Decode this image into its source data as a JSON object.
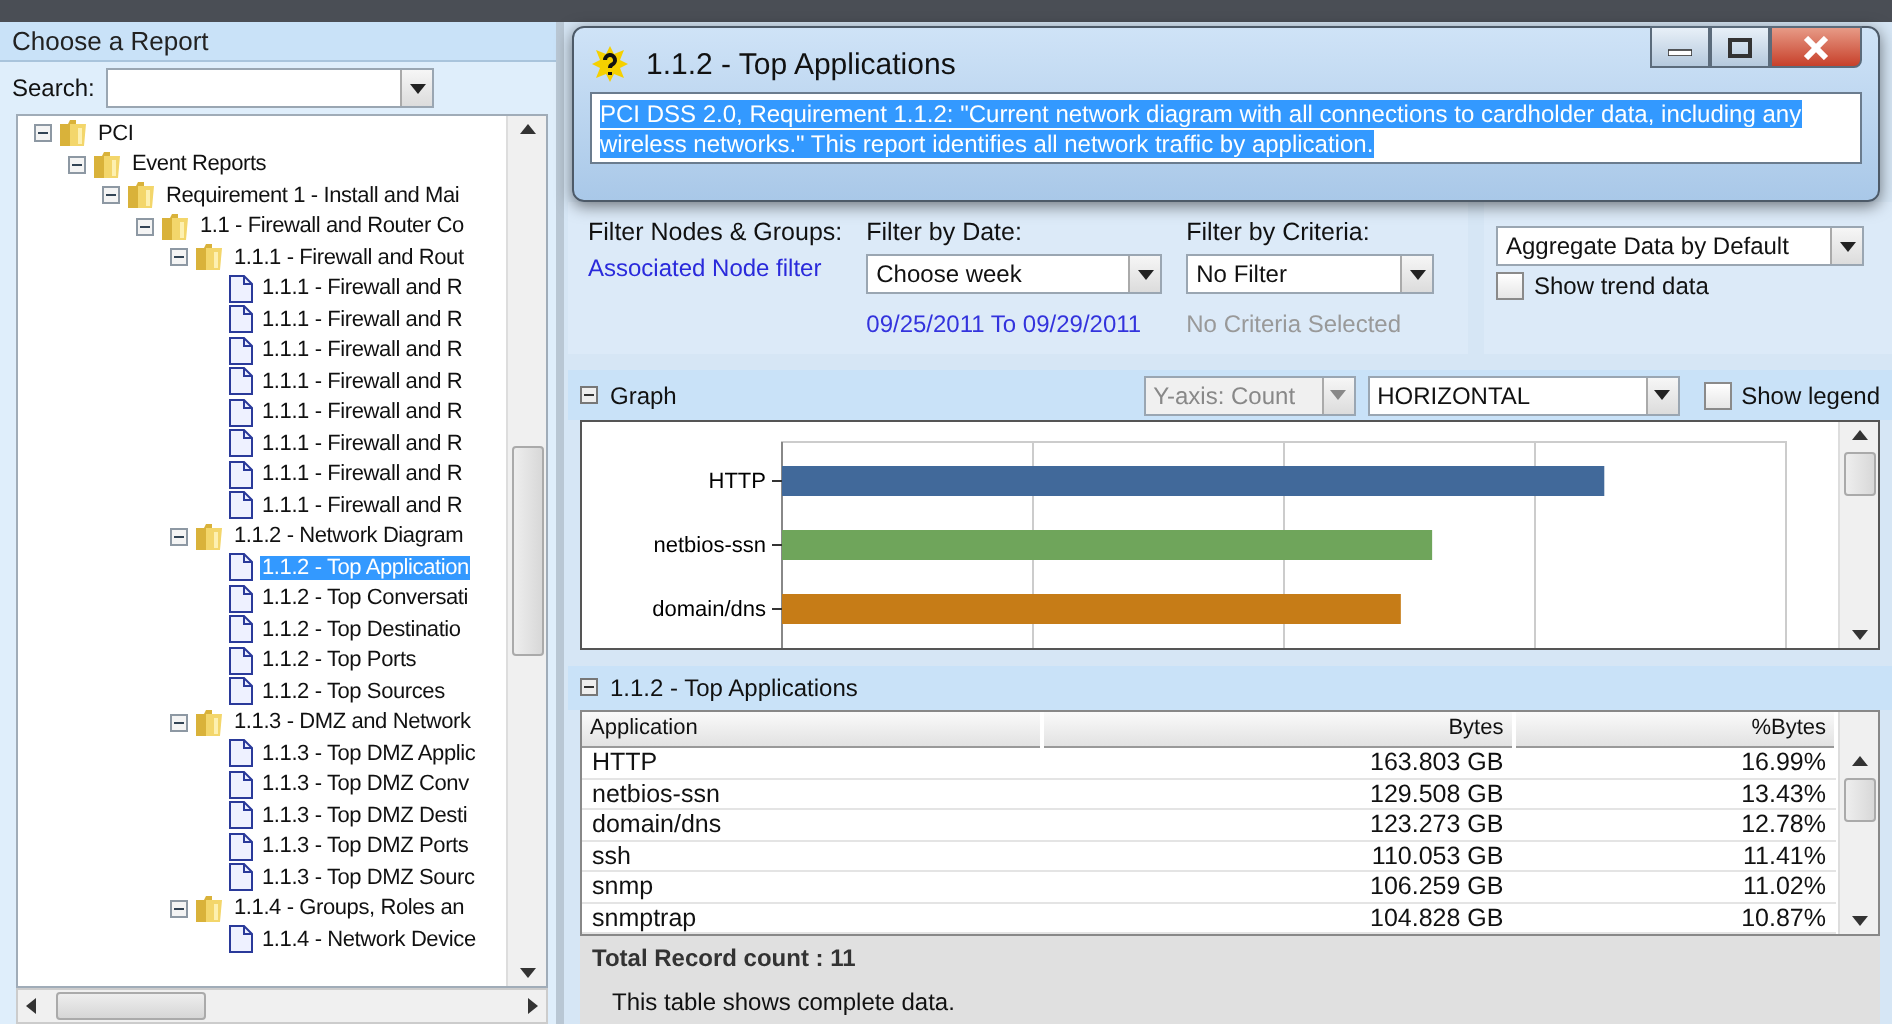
{
  "report_panel": {
    "title": "Choose a Report",
    "search": {
      "label": "Search:"
    },
    "tree": [
      {
        "label": "PCI",
        "kind": "folder",
        "expanded": true,
        "selected": false,
        "children": [
          {
            "label": "Event Reports",
            "kind": "folder",
            "expanded": true,
            "selected": false,
            "children": [
              {
                "label": "Requirement 1 - Install and Mai",
                "kind": "folder",
                "expanded": true,
                "selected": false,
                "children": [
                  {
                    "label": "1.1 - Firewall and Router Co",
                    "kind": "folder",
                    "expanded": true,
                    "selected": false,
                    "children": [
                      {
                        "label": "1.1.1 - Firewall and Rout",
                        "kind": "folder",
                        "expanded": true,
                        "selected": false,
                        "children": [
                          {
                            "label": "1.1.1 - Firewall and R",
                            "kind": "report",
                            "selected": false
                          },
                          {
                            "label": "1.1.1 - Firewall and R",
                            "kind": "report",
                            "selected": false
                          },
                          {
                            "label": "1.1.1 - Firewall and R",
                            "kind": "report",
                            "selected": false
                          },
                          {
                            "label": "1.1.1 - Firewall and R",
                            "kind": "report",
                            "selected": false
                          },
                          {
                            "label": "1.1.1 - Firewall and R",
                            "kind": "report",
                            "selected": false
                          },
                          {
                            "label": "1.1.1 - Firewall and R",
                            "kind": "report",
                            "selected": false
                          },
                          {
                            "label": "1.1.1 - Firewall and R",
                            "kind": "report",
                            "selected": false
                          },
                          {
                            "label": "1.1.1 - Firewall and R",
                            "kind": "report",
                            "selected": false
                          }
                        ]
                      },
                      {
                        "label": "1.1.2 - Network Diagram",
                        "kind": "folder",
                        "expanded": true,
                        "selected": false,
                        "children": [
                          {
                            "label": "1.1.2 - Top Application",
                            "kind": "report",
                            "selected": true
                          },
                          {
                            "label": "1.1.2 - Top Conversati",
                            "kind": "report",
                            "selected": false
                          },
                          {
                            "label": "1.1.2 - Top Destinatio",
                            "kind": "report",
                            "selected": false
                          },
                          {
                            "label": "1.1.2 - Top Ports",
                            "kind": "report",
                            "selected": false
                          },
                          {
                            "label": "1.1.2 - Top Sources",
                            "kind": "report",
                            "selected": false
                          }
                        ]
                      },
                      {
                        "label": "1.1.3 - DMZ and Network",
                        "kind": "folder",
                        "expanded": true,
                        "selected": false,
                        "children": [
                          {
                            "label": "1.1.3 - Top DMZ Applic",
                            "kind": "report",
                            "selected": false
                          },
                          {
                            "label": "1.1.3 - Top DMZ Conv",
                            "kind": "report",
                            "selected": false
                          },
                          {
                            "label": "1.1.3 - Top DMZ Desti",
                            "kind": "report",
                            "selected": false
                          },
                          {
                            "label": "1.1.3 - Top DMZ Ports",
                            "kind": "report",
                            "selected": false
                          },
                          {
                            "label": "1.1.3 - Top DMZ Sourc",
                            "kind": "report",
                            "selected": false
                          }
                        ]
                      },
                      {
                        "label": "1.1.4 - Groups, Roles an",
                        "kind": "folder",
                        "expanded": true,
                        "selected": false,
                        "children": [
                          {
                            "label": "1.1.4 - Network Device",
                            "kind": "report",
                            "selected": false
                          }
                        ]
                      }
                    ]
                  }
                ]
              }
            ]
          }
        ]
      }
    ]
  },
  "dialog": {
    "title": "1.1.2 - Top Applications",
    "description": "PCI DSS 2.0, Requirement 1.1.2: \"Current network diagram with all connections to cardholder data, including any wireless networks.\" This report identifies all network traffic by application."
  },
  "filters": {
    "nodes": {
      "label": "Filter Nodes & Groups:",
      "link": "Associated Node filter"
    },
    "date": {
      "label": "Filter by Date:",
      "value": "Choose week",
      "range": "09/25/2011 To 09/29/2011"
    },
    "criteria": {
      "label": "Filter by Criteria:",
      "value": "No Filter",
      "status": "No Criteria Selected"
    },
    "aggregate": {
      "value": "Aggregate Data by Default"
    },
    "trend": {
      "label": "Show trend data",
      "checked": false
    }
  },
  "graph": {
    "title": "Graph",
    "yaxis": {
      "value": "Y-axis: Count",
      "disabled": true
    },
    "orientation": {
      "value": "HORIZONTAL"
    },
    "legend": {
      "label": "Show legend",
      "checked": false
    },
    "bars": [
      {
        "label": "HTTP",
        "color": "#41699a"
      },
      {
        "label": "netbios-ssn",
        "color": "#6fa55b"
      },
      {
        "label": "domain/dns",
        "color": "#c67c17"
      }
    ]
  },
  "table": {
    "title": "1.1.2 - Top Applications",
    "columns": [
      "Application",
      "Bytes",
      "%Bytes"
    ],
    "rows": [
      [
        "HTTP",
        "163.803 GB",
        "16.99%"
      ],
      [
        "netbios-ssn",
        "129.508 GB",
        "13.43%"
      ],
      [
        "domain/dns",
        "123.273 GB",
        "12.78%"
      ],
      [
        "ssh",
        "110.053 GB",
        "11.41%"
      ],
      [
        "snmp",
        "106.259 GB",
        "11.02%"
      ],
      [
        "snmptrap",
        "104.828 GB",
        "10.87%"
      ]
    ],
    "total": "Total Record count : 11",
    "note": "This table shows complete data."
  }
}
